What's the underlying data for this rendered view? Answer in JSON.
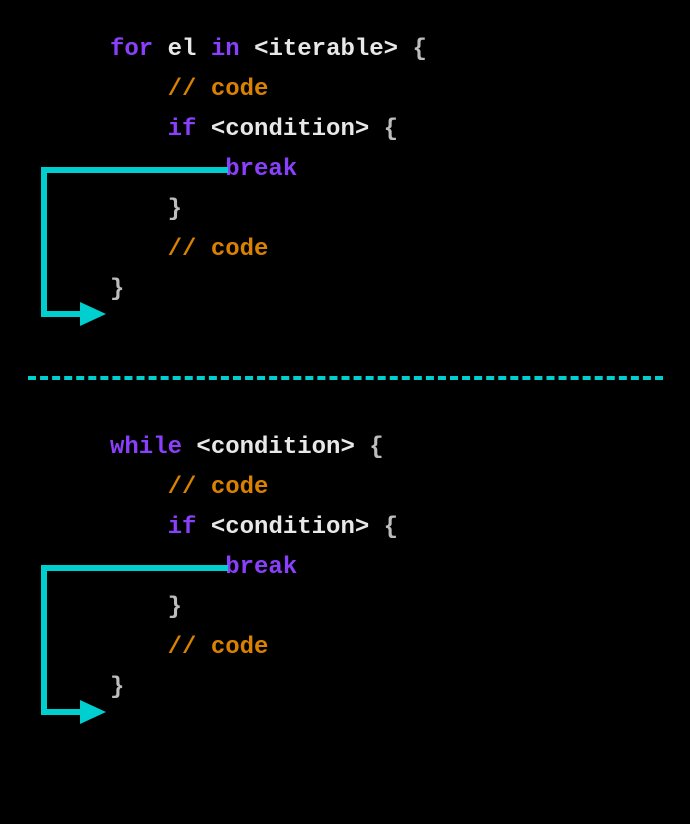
{
  "for_block": {
    "line1": {
      "for": "for",
      "el": "el",
      "in": "in",
      "iter": "<iterable>",
      "brace_open": " {"
    },
    "line2": {
      "comment": "// code"
    },
    "line3": {
      "if": "if",
      "cond": "<condition>",
      "brace_open": " {"
    },
    "line4": {
      "break": "break"
    },
    "line5": {
      "brace_close": "}"
    },
    "line6": {
      "comment": "// code"
    },
    "line7": {
      "brace_close": "}"
    }
  },
  "while_block": {
    "line1": {
      "while": "while",
      "cond": "<condition>",
      "brace_open": " {"
    },
    "line2": {
      "comment": "// code"
    },
    "line3": {
      "if": "if",
      "cond": "<condition>",
      "brace_open": " {"
    },
    "line4": {
      "break": "break"
    },
    "line5": {
      "brace_close": "}"
    },
    "line6": {
      "comment": "// code"
    },
    "line7": {
      "brace_close": "}"
    }
  }
}
